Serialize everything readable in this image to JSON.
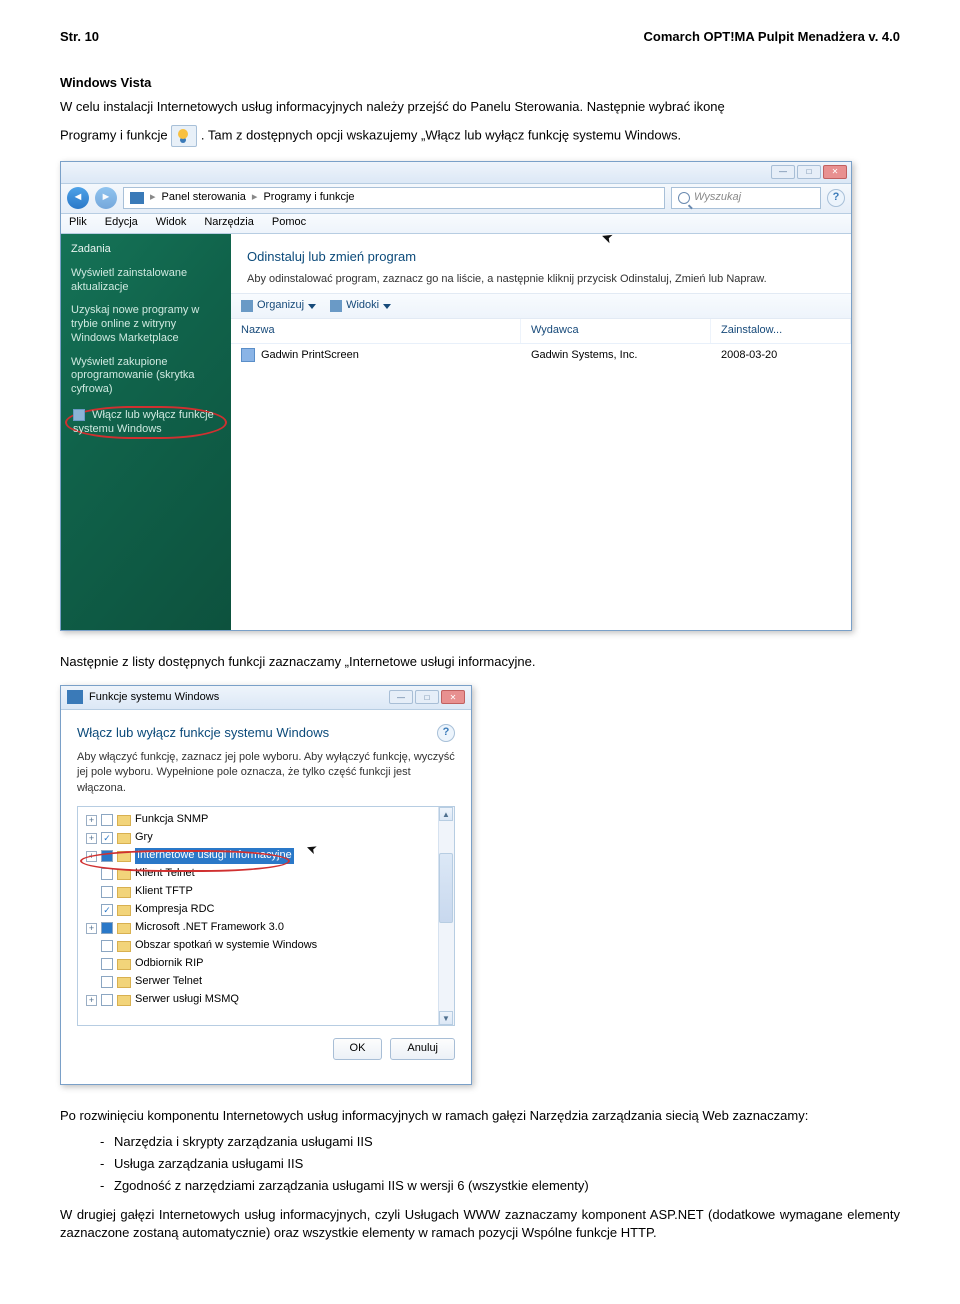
{
  "header": {
    "left": "Str. 10",
    "right": "Comarch OPT!MA Pulpit Menadżera v. 4.0"
  },
  "section1_title": "Windows Vista",
  "p1": "W celu instalacji Internetowych usług informacyjnych należy przejść do Panelu Sterowania. Następnie wybrać ikonę",
  "p1b": "Programy i funkcje ",
  "p1c": ". Tam z dostępnych opcji wskazujemy „Włącz lub wyłącz funkcję systemu Windows.",
  "cp": {
    "addr": {
      "crumb1": "Panel sterowania",
      "crumb2": "Programy i funkcje"
    },
    "search_ph": "Wyszukaj",
    "menu": [
      "Plik",
      "Edycja",
      "Widok",
      "Narzędzia",
      "Pomoc"
    ],
    "sidebar_title": "Zadania",
    "tasks": [
      "Wyświetl zainstalowane aktualizacje",
      "Uzyskaj nowe programy w trybie online z witryny Windows Marketplace",
      "Wyświetl zakupione oprogramowanie (skrytka cyfrowa)",
      "Włącz lub wyłącz funkcje systemu Windows"
    ],
    "main_title": "Odinstaluj lub zmień program",
    "main_desc": "Aby odinstalować program, zaznacz go na liście, a następnie kliknij przycisk Odinstaluj, Zmień lub Napraw.",
    "toolbar": {
      "organize": "Organizuj",
      "views": "Widoki"
    },
    "columns": {
      "c1": "Nazwa",
      "c2": "Wydawca",
      "c3": "Zainstalow..."
    },
    "row": {
      "name": "Gadwin PrintScreen",
      "pub": "Gadwin Systems, Inc.",
      "date": "2008-03-20"
    }
  },
  "p2": "Następnie z listy dostępnych funkcji zaznaczamy „Internetowe usługi informacyjne.",
  "feat": {
    "win_title": "Funkcje systemu Windows",
    "heading": "Włącz lub wyłącz funkcje systemu Windows",
    "desc": "Aby włączyć funkcję, zaznacz jej pole wyboru. Aby wyłączyć funkcję, wyczyść jej pole wyboru. Wypełnione pole oznacza, że tylko część funkcji jest włączona.",
    "items": [
      {
        "plus": "+",
        "chk": "",
        "label": "Funkcja SNMP"
      },
      {
        "plus": "+",
        "chk": "✓",
        "label": "Gry"
      },
      {
        "plus": "+",
        "chk": "partial",
        "label": "Internetowe usługi informacyjne",
        "selected": true
      },
      {
        "plus": "",
        "chk": "",
        "label": "Klient Telnet"
      },
      {
        "plus": "",
        "chk": "",
        "label": "Klient TFTP"
      },
      {
        "plus": "",
        "chk": "✓",
        "label": "Kompresja RDC"
      },
      {
        "plus": "+",
        "chk": "partial",
        "label": "Microsoft .NET Framework 3.0"
      },
      {
        "plus": "",
        "chk": "",
        "label": "Obszar spotkań w systemie Windows"
      },
      {
        "plus": "",
        "chk": "",
        "label": "Odbiornik RIP"
      },
      {
        "plus": "",
        "chk": "",
        "label": "Serwer Telnet"
      },
      {
        "plus": "+",
        "chk": "",
        "label": "Serwer usługi MSMQ"
      }
    ],
    "ok": "OK",
    "cancel": "Anuluj"
  },
  "p3": "Po rozwinięciu komponentu Internetowych usług informacyjnych w ramach gałęzi Narzędzia zarządzania siecią Web zaznaczamy:",
  "bullets": [
    "Narzędzia i skrypty zarządzania usługami IIS",
    "Usługa zarządzania usługami IIS",
    "Zgodność z narzędziami zarządzania usługami IIS w wersji 6 (wszystkie elementy)"
  ],
  "p4": "W drugiej gałęzi Internetowych usług informacyjnych, czyli Usługach WWW zaznaczamy komponent ASP.NET (dodatkowe wymagane elementy zaznaczone zostaną automatycznie) oraz wszystkie elementy w ramach pozycji Wspólne funkcje HTTP."
}
